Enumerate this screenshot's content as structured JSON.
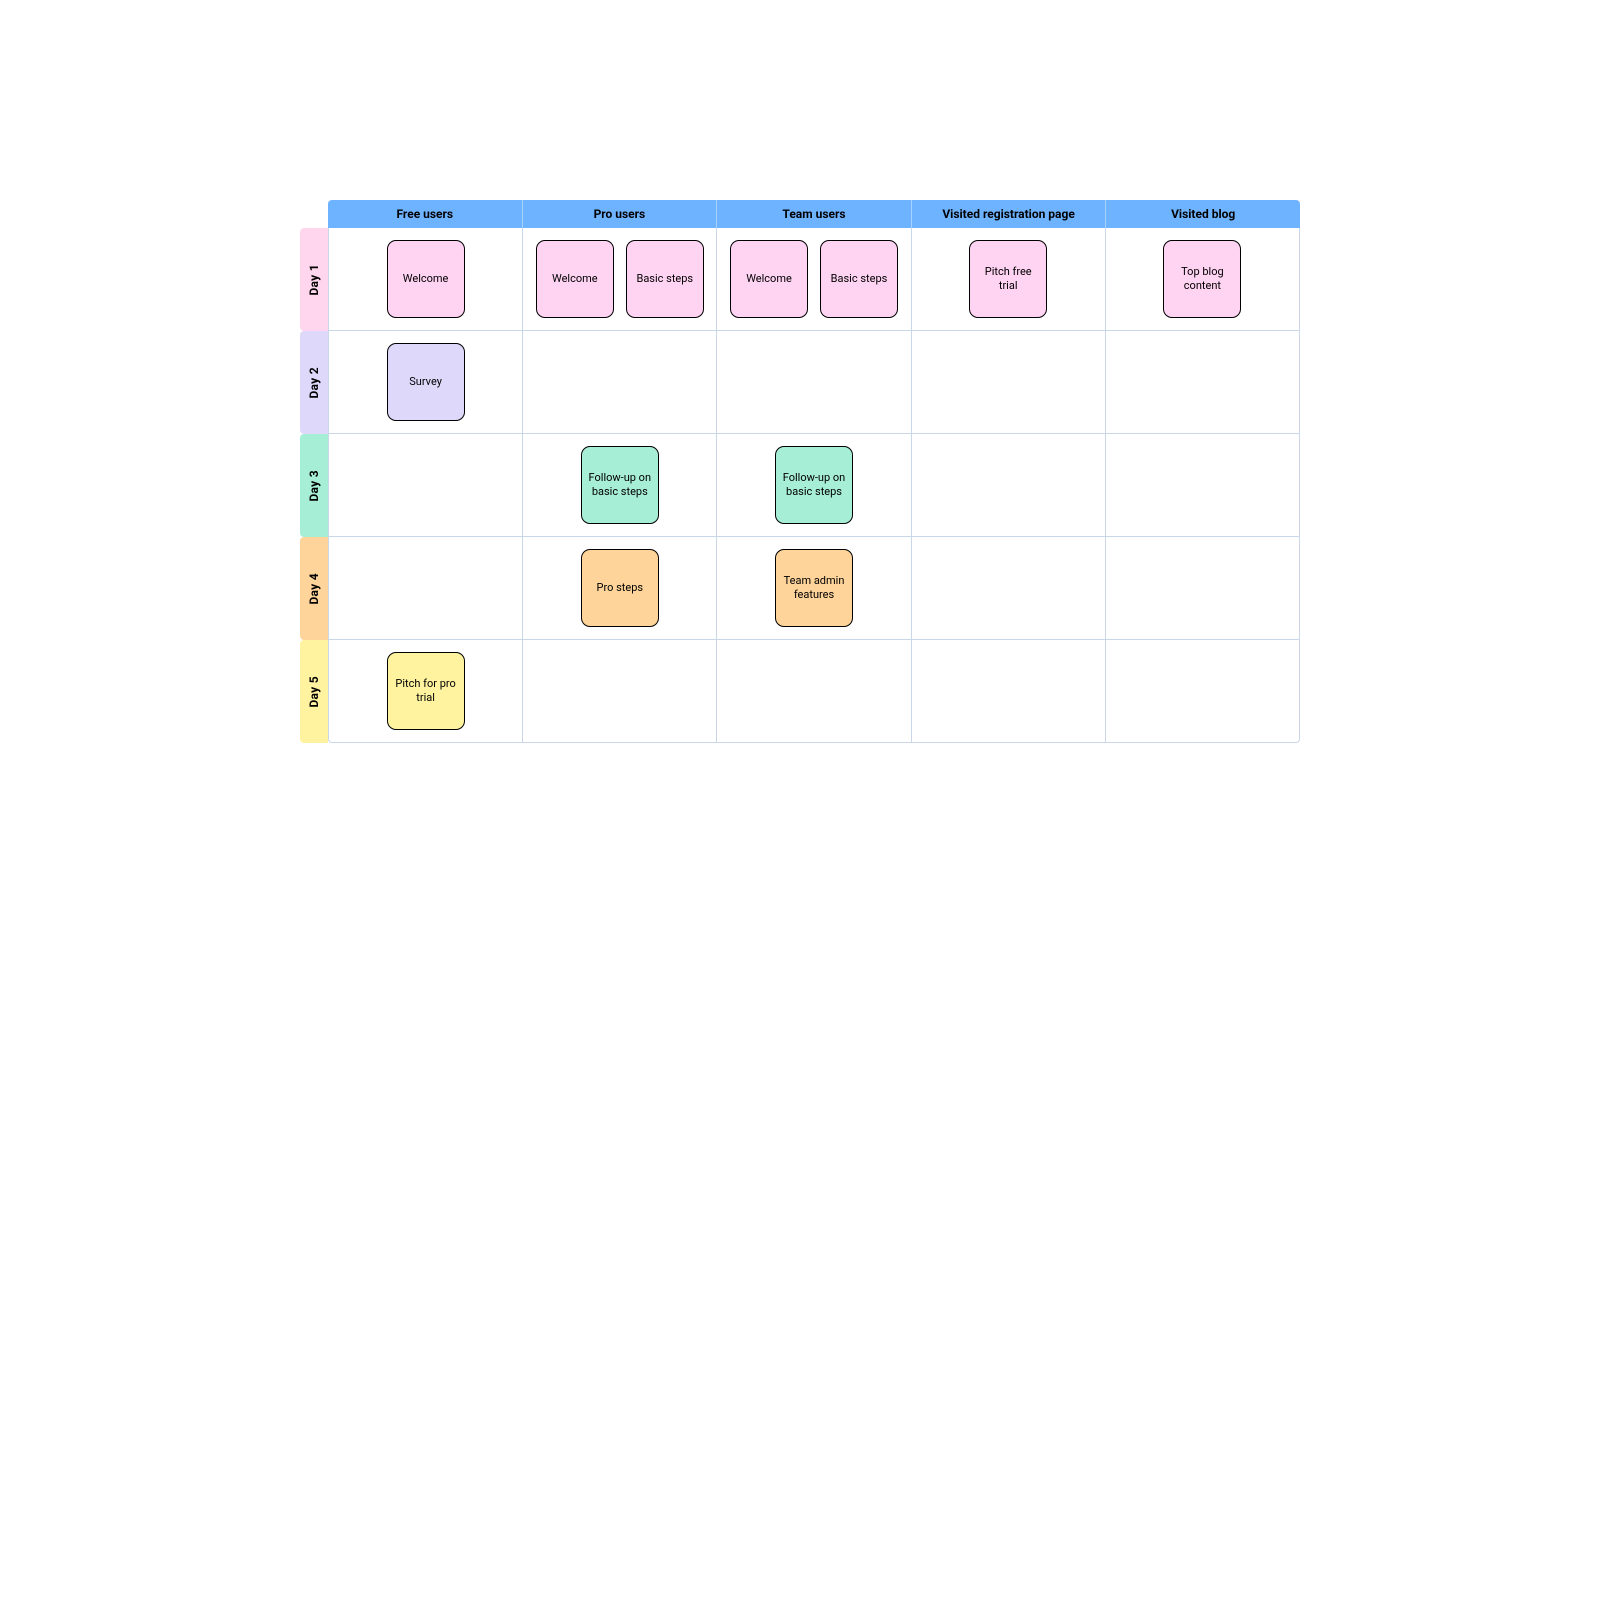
{
  "columns": [
    "Free users",
    "Pro users",
    "Team users",
    "Visited registration page",
    "Visited blog"
  ],
  "rows": [
    {
      "label": "Day 1",
      "colorClass": "day1",
      "cardColor": "pink"
    },
    {
      "label": "Day 2",
      "colorClass": "day2",
      "cardColor": "purple"
    },
    {
      "label": "Day 3",
      "colorClass": "day3",
      "cardColor": "teal"
    },
    {
      "label": "Day 4",
      "colorClass": "day4",
      "cardColor": "orange"
    },
    {
      "label": "Day 5",
      "colorClass": "day5",
      "cardColor": "yellow"
    }
  ],
  "cells": {
    "r0c0": [
      "Welcome"
    ],
    "r0c1": [
      "Welcome",
      "Basic steps"
    ],
    "r0c2": [
      "Welcome",
      "Basic steps"
    ],
    "r0c3": [
      "Pitch free trial"
    ],
    "r0c4": [
      "Top blog content"
    ],
    "r1c0": [
      "Survey"
    ],
    "r1c1": [],
    "r1c2": [],
    "r1c3": [],
    "r1c4": [],
    "r2c0": [],
    "r2c1": [
      "Follow-up on basic steps"
    ],
    "r2c2": [
      "Follow-up on basic steps"
    ],
    "r2c3": [],
    "r2c4": [],
    "r3c0": [],
    "r3c1": [
      "Pro steps"
    ],
    "r3c2": [
      "Team admin features"
    ],
    "r3c3": [],
    "r3c4": [],
    "r4c0": [
      "Pitch for pro trial"
    ],
    "r4c1": [],
    "r4c2": [],
    "r4c3": [],
    "r4c4": []
  }
}
